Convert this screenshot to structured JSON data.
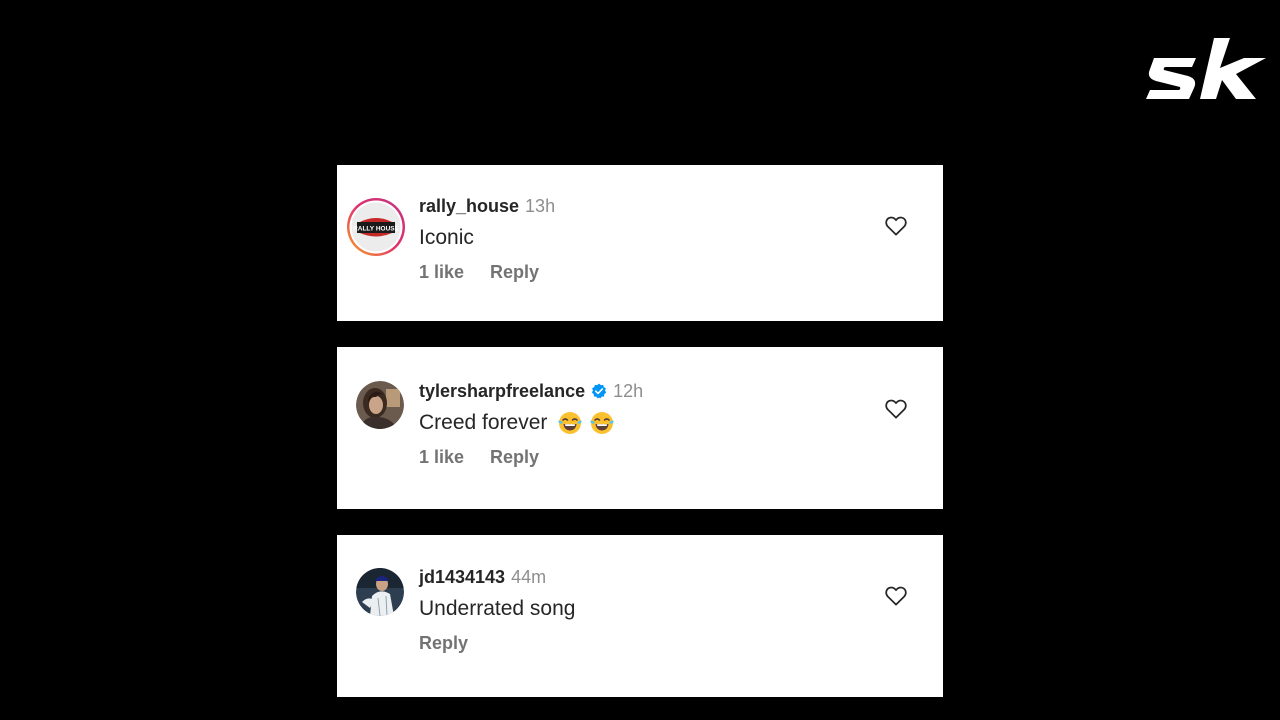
{
  "brand": {
    "logo_icon": "sk-logo",
    "color": "#ffffff"
  },
  "comments": [
    {
      "username": "rally_house",
      "time": "13h",
      "verified": false,
      "text": "Iconic",
      "likes": "1 like",
      "reply": "Reply",
      "avatar_icon": "rally-house-logo-icon",
      "avatar_text": "RALLY HOUSE"
    },
    {
      "username": "tylersharpfreelance",
      "time": "12h",
      "verified": true,
      "text": "Creed forever",
      "emojis": [
        "face-with-tears-of-joy",
        "face-with-tears-of-joy"
      ],
      "likes": "1 like",
      "reply": "Reply",
      "avatar_icon": "profile-photo-icon"
    },
    {
      "username": "jd1434143",
      "time": "44m",
      "verified": false,
      "text": "Underrated song",
      "likes": "",
      "reply": "Reply",
      "avatar_icon": "profile-photo-icon"
    }
  ],
  "colors": {
    "background": "#000000",
    "card": "#ffffff",
    "text": "#262626",
    "muted": "#8e8e8e",
    "action": "#737373",
    "verified": "#0095f6"
  }
}
